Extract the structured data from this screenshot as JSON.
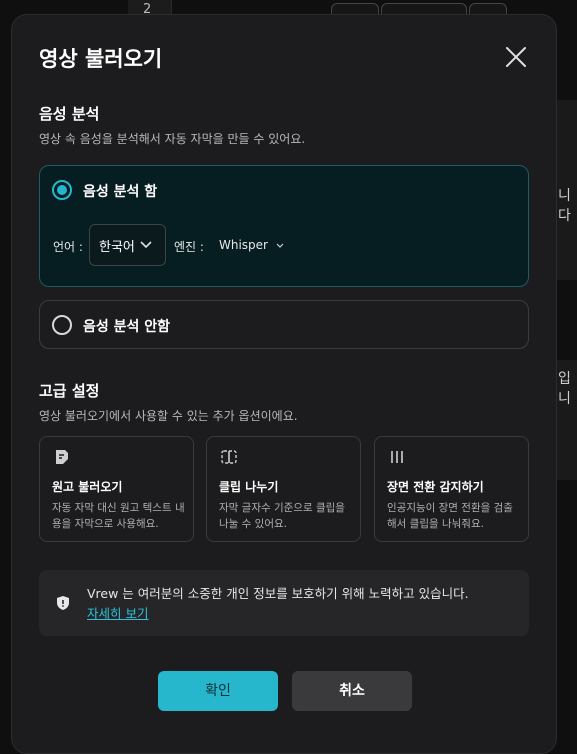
{
  "background": {
    "page_number": "2",
    "right_fragments": [
      "니다",
      "입니"
    ]
  },
  "modal": {
    "title": "영상 불러오기"
  },
  "speech_section": {
    "title": "음성 분석",
    "description": "영상 속 음성을 분석해서 자동 자막을 만들 수 있어요.",
    "option_on_label": "음성 분석 함",
    "option_off_label": "음성 분석 안함",
    "selected": "on",
    "language_label": "언어 :",
    "language_value": "한국어",
    "engine_label": "엔진 :",
    "engine_value": "Whisper"
  },
  "advanced_section": {
    "title": "고급 설정",
    "description": "영상 불러오기에서 사용할 수 있는 추가 옵션이에요.",
    "options": [
      {
        "title": "원고 불러오기",
        "desc": "자동 자막 대신 원고 텍스트 내용을 자막으로 사용해요.",
        "icon": "document-edit-icon"
      },
      {
        "title": "클립 나누기",
        "desc": "자막 글자수 기준으로 클립을 나눌 수 있어요.",
        "icon": "split-clip-icon"
      },
      {
        "title": "장면 전환 감지하기",
        "desc": "인공지능이 장면 전환을 검출해서 클립을 나눠줘요.",
        "icon": "scene-bars-icon"
      }
    ]
  },
  "privacy": {
    "text": "Vrew 는 여러분의 소중한 개인 정보를 보호하기 위해 노력하고 있습니다.",
    "link": "자세히 보기"
  },
  "buttons": {
    "confirm": "확인",
    "cancel": "취소"
  },
  "colors": {
    "accent": "#27b7cd",
    "modal_bg": "#1c1c1e",
    "selected_card_bg": "#061d22"
  }
}
